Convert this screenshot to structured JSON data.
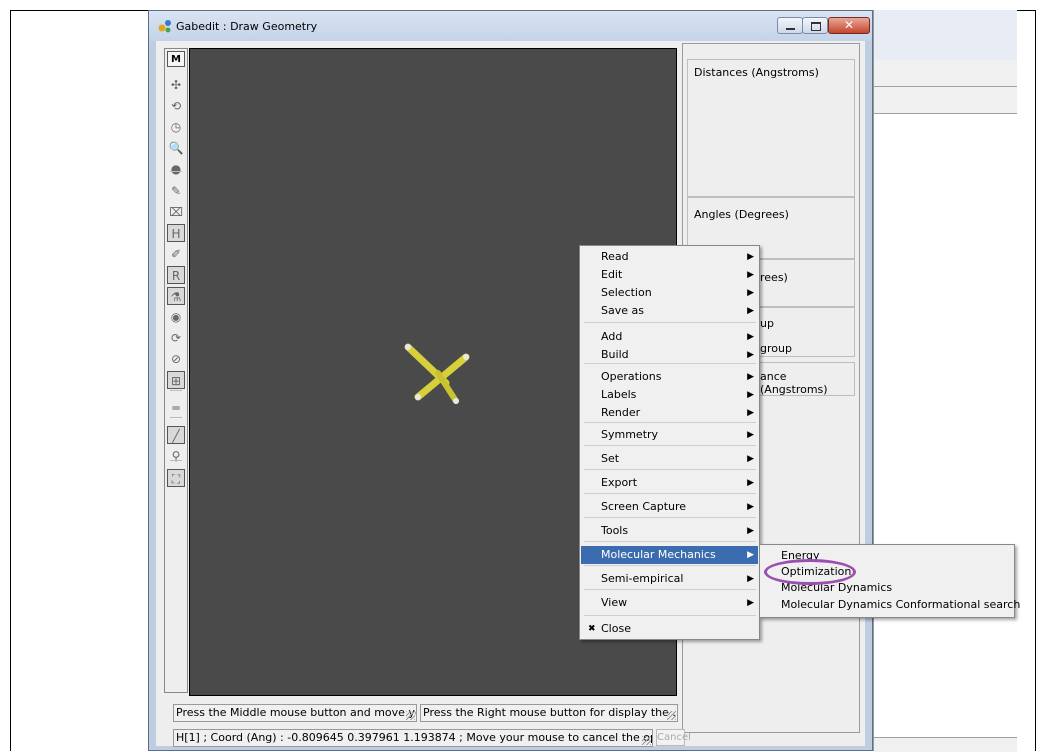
{
  "window": {
    "title": "Gabedit : Draw Geometry",
    "close_glyph": "✕"
  },
  "toolbar": {
    "mode_label": "M",
    "tools": [
      {
        "icon": "translate-icon",
        "glyph": "✣"
      },
      {
        "icon": "rotate-icon",
        "glyph": "⟲"
      },
      {
        "icon": "rotate-z-icon",
        "glyph": "◷"
      },
      {
        "icon": "zoom-icon",
        "glyph": "🔍"
      },
      {
        "icon": "scale-icon",
        "glyph": "●"
      },
      {
        "icon": "draw-icon",
        "glyph": "✎"
      },
      {
        "icon": "delete-icon",
        "glyph": "⌧"
      },
      {
        "icon": "hydrogen-icon",
        "glyph": "H"
      },
      {
        "icon": "edit-object-icon",
        "glyph": "✐"
      },
      {
        "icon": "replace-icon",
        "glyph": "R"
      },
      {
        "icon": "atom-fragment-icon",
        "glyph": "⚗"
      },
      {
        "icon": "insert-fragment-icon",
        "glyph": "◉"
      },
      {
        "icon": "rotate-fragment-icon",
        "glyph": "⟳"
      },
      {
        "icon": "delete-fragment-icon",
        "glyph": "⊘"
      },
      {
        "icon": "move-fragment-icon",
        "glyph": "⊞"
      },
      {
        "icon": "bond-icon",
        "glyph": "═"
      },
      {
        "icon": "stick-mode-icon",
        "glyph": "╱"
      },
      {
        "icon": "ball-stick-icon",
        "glyph": "⚲"
      },
      {
        "icon": "fullscreen-icon",
        "glyph": "⛶"
      }
    ]
  },
  "right_panel": {
    "distances_label": "Distances (Angstroms)",
    "angles_label": "Angles (Degrees)",
    "dihedral_partial": "rees)",
    "group_partial_1": "up",
    "group_partial_2": "group",
    "distance_partial": "ance (Angstroms)"
  },
  "status": {
    "middle_hint": "Press the Middle mouse button and move yo...",
    "right_hint": "Press the Right mouse button for display the ...",
    "coord_line": "H[1] ; Coord (Ang) : -0.809645 0.397961 1.193874 ; Move your mouse to cancel the op...",
    "cancel_label": "Cancel"
  },
  "context_menu": {
    "items": [
      {
        "label": "Read",
        "submenu": true
      },
      {
        "label": "Edit",
        "submenu": true
      },
      {
        "label": "Selection",
        "submenu": true
      },
      {
        "label": "Save as",
        "submenu": true
      },
      {
        "label": "Add",
        "submenu": true
      },
      {
        "label": "Build",
        "submenu": true
      },
      {
        "label": "Operations",
        "submenu": true
      },
      {
        "label": "Labels",
        "submenu": true
      },
      {
        "label": "Render",
        "submenu": true
      },
      {
        "label": "Symmetry",
        "submenu": true
      },
      {
        "label": "Set",
        "submenu": true
      },
      {
        "label": "Export",
        "submenu": true
      },
      {
        "label": "Screen Capture",
        "submenu": true
      },
      {
        "label": "Tools",
        "submenu": true
      },
      {
        "label": "Molecular Mechanics",
        "submenu": true,
        "highlighted": true
      },
      {
        "label": "Semi-empirical",
        "submenu": true
      },
      {
        "label": "View",
        "submenu": true
      },
      {
        "label": "Close",
        "submenu": false,
        "icon": "close-icon",
        "icon_glyph": "✖"
      }
    ],
    "arrow_glyph": "▶"
  },
  "submenu": {
    "items": [
      {
        "label": "Energy"
      },
      {
        "label": "Optimization"
      },
      {
        "label": "Molecular Dynamics"
      },
      {
        "label": "Molecular Dynamics Conformational search"
      }
    ]
  },
  "colors": {
    "canvas": "#4a4a4a",
    "menu_highlight": "#3c6cb0",
    "annotation_circle": "#9b4fb1",
    "bond_yellow": "#d8d03a",
    "hydrogen_white": "#e8e8e8"
  }
}
